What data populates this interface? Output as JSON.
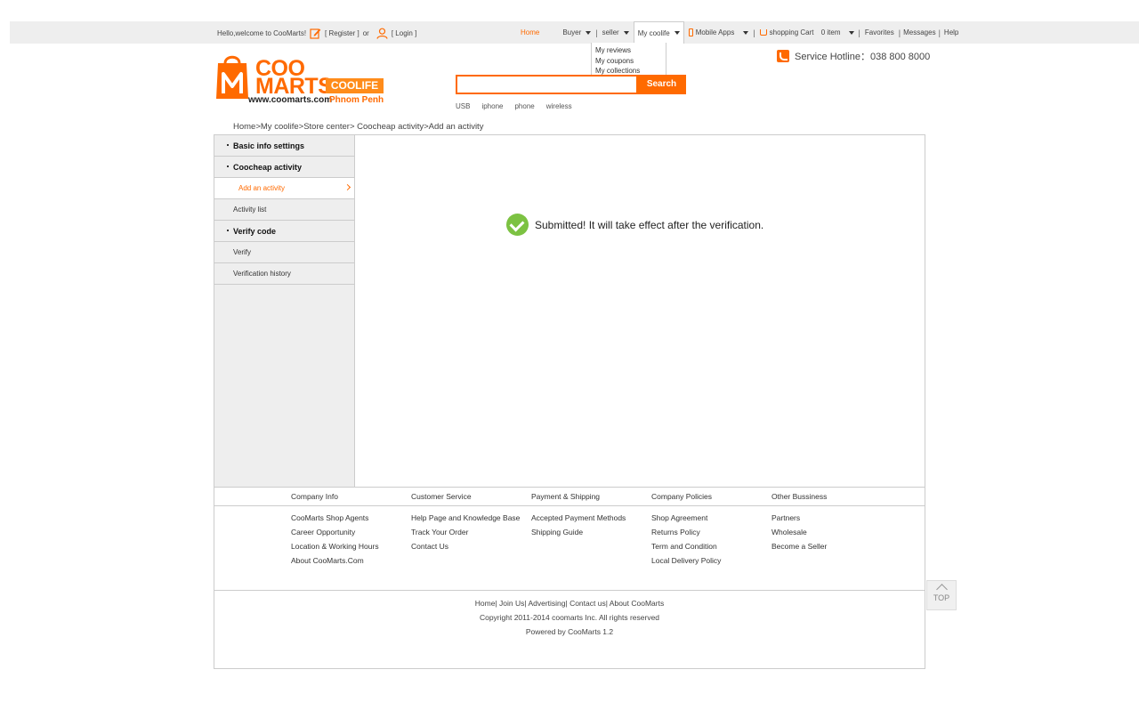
{
  "topbar": {
    "welcome": "Hello,welcome to CooMarts!",
    "register": "[ Register ]",
    "or": "or",
    "login": "[ Login ]",
    "nav": {
      "home": "Home",
      "buyer": "Buyer",
      "seller": "seller",
      "mycoolife": "My coolife",
      "mobile_apps": "Mobile Apps",
      "cart": "shopping Cart",
      "cart_count": "0 item",
      "favorites": "Favorites",
      "messages": "Messages",
      "help": "Help"
    },
    "dropdown": [
      "My reviews",
      "My coupons",
      "My collections"
    ]
  },
  "header": {
    "logo_coo": "COO",
    "logo_marts": "MARTS",
    "logo_coolife": "COOLIFE",
    "logo_url": "www.coomarts.com",
    "logo_city": "Phnom Penh",
    "search": {
      "placeholder": "",
      "button": "Search"
    },
    "hot_keywords": [
      "USB",
      "iphone",
      "phone",
      "wireless"
    ],
    "hotline_label": "Service Hotline：",
    "hotline_number": "038 800 8000"
  },
  "breadcrumb": "Home>My coolife>Store center> Coocheap activity>Add an activity",
  "sidebar": {
    "basic_info": "Basic info settings",
    "coocheap": "Coocheap activity",
    "add_activity": "Add an activity",
    "activity_list": "Activity list",
    "verify_code": "Verify code",
    "verify": "Verify",
    "verification_history": "Verification history"
  },
  "message": "Submitted! It will take effect after the verification.",
  "footer": {
    "columns": [
      {
        "title": "Company Info",
        "links": [
          "CooMarts Shop Agents",
          "Career Opportunity",
          "Location & Working Hours",
          "About CooMarts.Com"
        ]
      },
      {
        "title": "Customer Service",
        "links": [
          "Help Page and Knowledge Base",
          "Track Your Order",
          "Contact Us"
        ]
      },
      {
        "title": "Payment & Shipping",
        "links": [
          "Accepted Payment Methods",
          "Shipping Guide"
        ]
      },
      {
        "title": "Company Policies",
        "links": [
          "Shop Agreement",
          "Returns Policy",
          "Term and Condition",
          "Local Delivery Policy"
        ]
      },
      {
        "title": "Other Bussiness",
        "links": [
          "Partners",
          "Wholesale",
          "Become a Seller"
        ]
      }
    ],
    "bottom_links": "Home| Join Us| Advertising| Contact us| About CooMarts",
    "copyright": "Copyright 2011-2014 coomarts Inc. All rights reserved",
    "powered": "Powered by CooMarts 1.2"
  },
  "back_to_top": "TOP",
  "colors": {
    "accent": "#ff6a00",
    "success": "#7cc242"
  }
}
